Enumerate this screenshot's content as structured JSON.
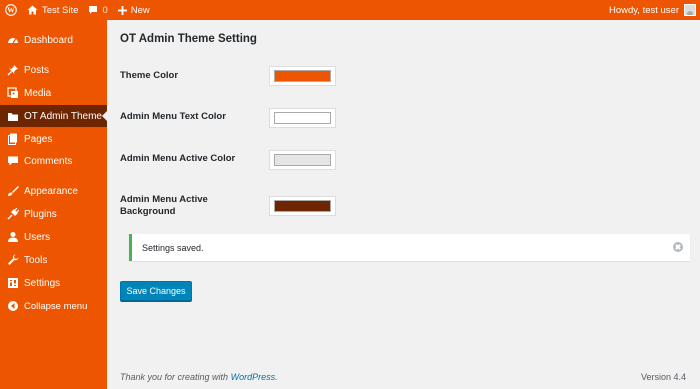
{
  "adminbar": {
    "site_name": "Test Site",
    "comment_count": "0",
    "new_label": "New",
    "greeting": "Howdy, test user"
  },
  "sidebar": {
    "items": [
      {
        "label": "Dashboard",
        "icon": "dashboard-icon"
      },
      {
        "label": "Posts",
        "icon": "pin-icon"
      },
      {
        "label": "Media",
        "icon": "media-icon"
      },
      {
        "label": "OT Admin Theme",
        "icon": "folder-icon",
        "active": true
      },
      {
        "label": "Pages",
        "icon": "page-icon"
      },
      {
        "label": "Comments",
        "icon": "comment-icon"
      },
      {
        "label": "Appearance",
        "icon": "brush-icon"
      },
      {
        "label": "Plugins",
        "icon": "plug-icon"
      },
      {
        "label": "Users",
        "icon": "user-icon"
      },
      {
        "label": "Tools",
        "icon": "wrench-icon"
      },
      {
        "label": "Settings",
        "icon": "settings-icon"
      },
      {
        "label": "Collapse menu",
        "icon": "collapse-icon"
      }
    ]
  },
  "main": {
    "title": "OT Admin Theme Setting",
    "settings": [
      {
        "label": "Theme Color",
        "color": "#ee5500"
      },
      {
        "label": "Admin Menu Text Color",
        "color": "#ffffff"
      },
      {
        "label": "Admin Menu Active Color",
        "color": "#e5e5e5"
      },
      {
        "label": "Admin Menu Active Background",
        "color": "#6e2600"
      }
    ],
    "notice": "Settings saved.",
    "save_label": "Save Changes"
  },
  "footer": {
    "thanks_prefix": "Thank you for creating with",
    "wordpress_link": "WordPress",
    "thanks_suffix": ".",
    "version": "Version 4.4"
  },
  "colors": {
    "brand": "#ee5500",
    "active_bg": "#6e2600",
    "button": "#0085ba",
    "success": "#46b450"
  }
}
